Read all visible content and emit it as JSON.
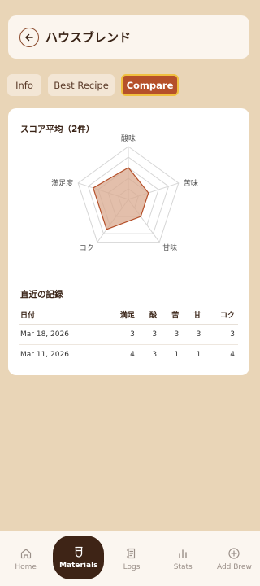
{
  "header": {
    "title": "ハウスブレンド"
  },
  "tabs": [
    {
      "label": "Info"
    },
    {
      "label": "Best Recipe"
    },
    {
      "label": "Compare"
    }
  ],
  "score_section": {
    "title": "スコア平均（2件）",
    "axes": [
      "酸味",
      "苦味",
      "甘味",
      "コク",
      "満足度"
    ],
    "max": 5,
    "values": [
      3,
      2,
      2,
      3.5,
      3.5
    ],
    "fill_color": "#d9a98f",
    "stroke_color": "#b5502a"
  },
  "records_section": {
    "title": "直近の記録",
    "headers": [
      "日付",
      "満足",
      "酸",
      "苦",
      "甘",
      "コク"
    ],
    "rows": [
      [
        "Mar 18, 2026",
        "3",
        "3",
        "3",
        "3",
        "3"
      ],
      [
        "Mar 11, 2026",
        "4",
        "3",
        "1",
        "1",
        "4"
      ]
    ]
  },
  "nav": [
    {
      "label": "Home",
      "icon": "home-icon"
    },
    {
      "label": "Materials",
      "icon": "cup-icon"
    },
    {
      "label": "Logs",
      "icon": "notes-icon"
    },
    {
      "label": "Stats",
      "icon": "bar-chart-icon"
    },
    {
      "label": "Add Brew",
      "icon": "plus-circle-icon"
    }
  ],
  "colors": {
    "accent": "#b5502a",
    "background": "#e9d5b7",
    "nav_active": "#3e2416"
  }
}
